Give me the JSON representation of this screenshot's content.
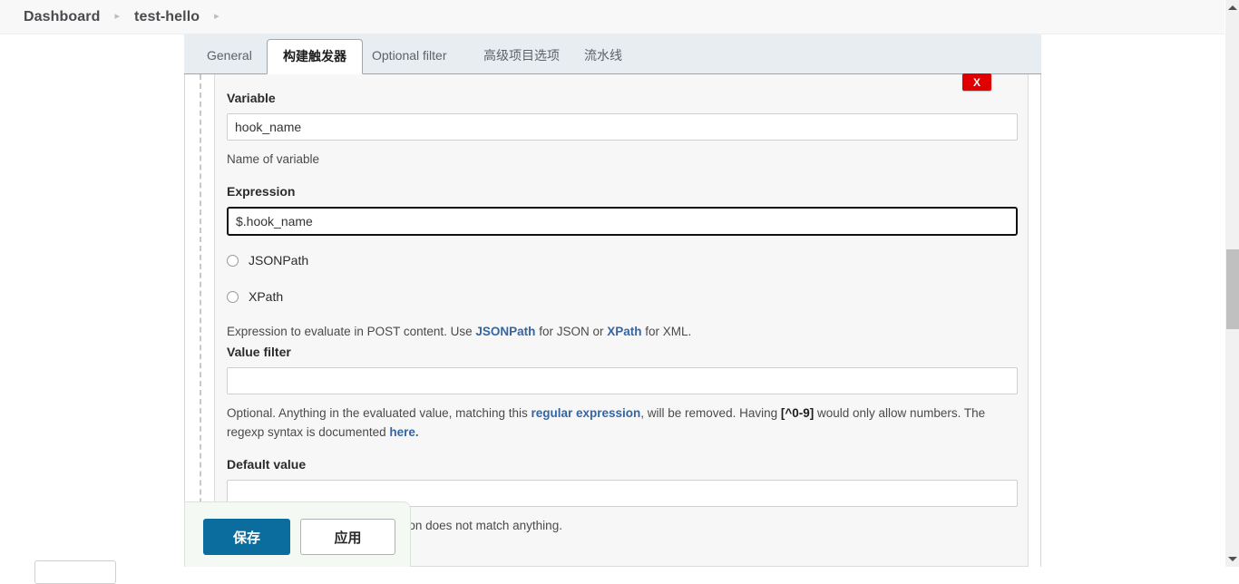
{
  "breadcrumb": {
    "items": [
      {
        "label": "Dashboard"
      },
      {
        "label": "test-hello"
      }
    ],
    "separator": "▸"
  },
  "tabs": [
    {
      "label": "General",
      "active": false
    },
    {
      "label": "构建触发器",
      "active": true
    },
    {
      "label": "Optional filter",
      "active": false
    },
    {
      "label": "高级项目选项",
      "active": false
    },
    {
      "label": "流水线",
      "active": false
    }
  ],
  "delete_button": {
    "label": "X",
    "color": "#e00000"
  },
  "form": {
    "variable": {
      "label": "Variable",
      "value": "hook_name",
      "placeholder": "",
      "help": "Name of variable"
    },
    "expression": {
      "label": "Expression",
      "value": "$.hook_name",
      "placeholder": "",
      "focused": true,
      "radios": [
        {
          "label": "JSONPath",
          "checked": false
        },
        {
          "label": "XPath",
          "checked": false
        }
      ],
      "help_prefix": "Expression to evaluate in POST content. Use ",
      "help_link_1": "JSONPath",
      "help_mid": " for JSON or ",
      "help_link_2": "XPath",
      "help_suffix": " for XML."
    },
    "value_filter": {
      "label": "Value filter",
      "value": "",
      "placeholder": "",
      "help_a": "Optional. Anything in the evaluated value, matching this ",
      "help_link": "regular expression",
      "help_b": ", will be removed. Having ",
      "help_bold": "[^0-9]",
      "help_c": " would only allow numbers. The regexp syntax is documented ",
      "help_link2": "here.",
      "help_d": ""
    },
    "default_value": {
      "label": "Default value",
      "value": "",
      "placeholder": "",
      "help": "This value will be used if expression does not match anything."
    }
  },
  "save_bar": {
    "save_label": "保存",
    "apply_label": "应用",
    "save_color": "#0b6d9e"
  },
  "scrollbar": {
    "up_icon": "chevron-up-icon",
    "down_icon": "chevron-down-icon"
  }
}
